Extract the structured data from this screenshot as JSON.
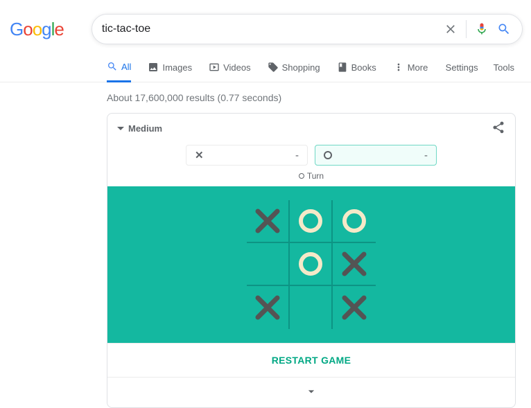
{
  "search": {
    "query": "tic-tac-toe"
  },
  "tabs": {
    "all": "All",
    "images": "Images",
    "videos": "Videos",
    "shopping": "Shopping",
    "books": "Books",
    "more": "More",
    "settings": "Settings",
    "tools": "Tools"
  },
  "stats": "About 17,600,000 results (0.77 seconds)",
  "game": {
    "difficulty": "Medium",
    "x_score": "-",
    "o_score": "-",
    "turn_label": "Turn",
    "restart": "RESTART GAME",
    "board": [
      "X",
      "O",
      "O",
      "",
      "O",
      "X",
      "X",
      "",
      "X"
    ]
  }
}
